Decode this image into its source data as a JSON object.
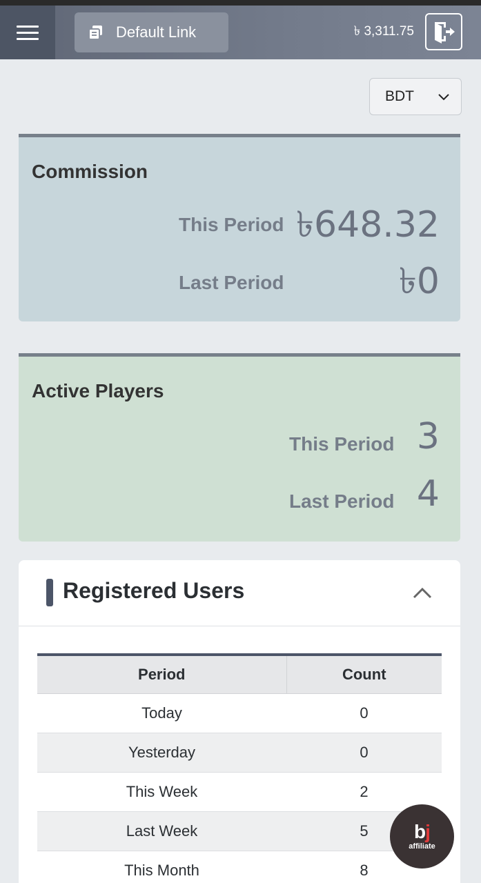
{
  "header": {
    "link_label": "Default Link",
    "balance": "৳ 3,311.75"
  },
  "currency_select": {
    "selected": "BDT"
  },
  "commission": {
    "title": "Commission",
    "this_period_label": "This Period",
    "this_period_value": "৳648.32",
    "last_period_label": "Last Period",
    "last_period_value": "৳0"
  },
  "active_players": {
    "title": "Active Players",
    "this_period_label": "This Period",
    "this_period_value": "3",
    "last_period_label": "Last Period",
    "last_period_value": "4"
  },
  "registered_users": {
    "title": "Registered Users",
    "columns": [
      "Period",
      "Count"
    ],
    "rows": [
      {
        "period": "Today",
        "count": "0"
      },
      {
        "period": "Yesterday",
        "count": "0"
      },
      {
        "period": "This Week",
        "count": "2"
      },
      {
        "period": "Last Week",
        "count": "5"
      },
      {
        "period": "This Month",
        "count": "8"
      }
    ]
  },
  "fab": {
    "logo_b": "b",
    "logo_j": "j",
    "sub": "affiliate"
  },
  "colors": {
    "header": "#6b7382",
    "commission_bg": "#c7d6db",
    "players_bg": "#cfe0d3",
    "accent": "#4c5568"
  },
  "icons": [
    "menu-icon",
    "link-icon",
    "logout-icon",
    "chevron-down-icon",
    "chevron-up-icon"
  ]
}
